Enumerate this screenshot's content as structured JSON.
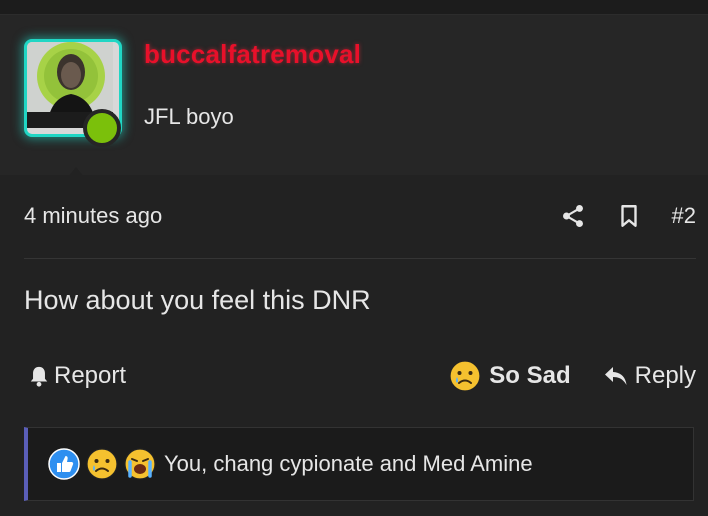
{
  "user": {
    "username": "buccalfatremoval",
    "title": "JFL boyo",
    "status": "online"
  },
  "post": {
    "timestamp": "4 minutes ago",
    "number": "#2",
    "message": "How about you feel this DNR"
  },
  "actions": {
    "report_label": "Report",
    "reaction_label": "So Sad",
    "reply_label": "Reply"
  },
  "reactions": {
    "icons": [
      "like-icon",
      "sad-icon",
      "crying-icon"
    ],
    "text": "You, chang cypionate and Med Amine"
  },
  "colors": {
    "username": "#e8102a",
    "avatar_border": "#20d6c4",
    "online": "#7bc00b",
    "reactions_accent": "#5a5eb8"
  }
}
